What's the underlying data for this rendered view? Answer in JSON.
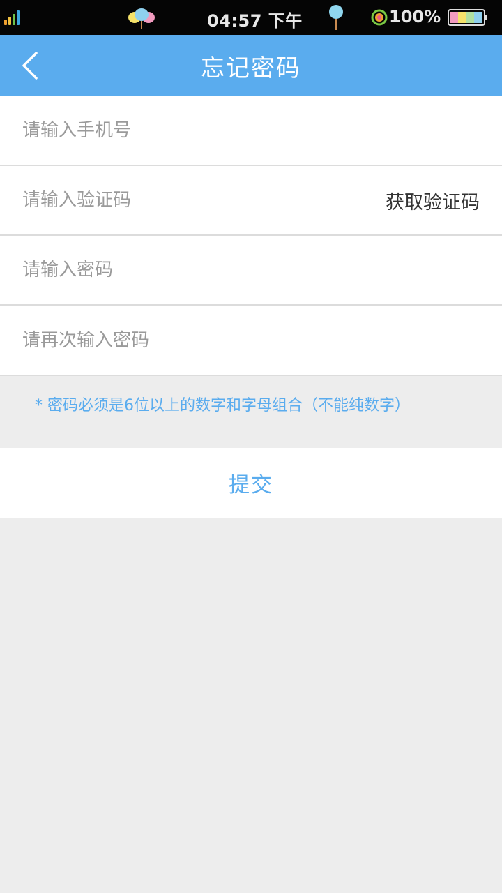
{
  "status_bar": {
    "time": "04:57 下午",
    "battery_percent": "100%",
    "icons": [
      "signal-icon",
      "balloons-icon",
      "pin-icon",
      "target-icon",
      "battery-icon"
    ]
  },
  "nav": {
    "title": "忘记密码",
    "back_icon": "chevron-left-icon"
  },
  "form": {
    "phone_placeholder": "请输入手机号",
    "code_placeholder": "请输入验证码",
    "get_code_label": "获取验证码",
    "password_placeholder": "请输入密码",
    "confirm_placeholder": "请再次输入密码"
  },
  "hint": "* 密码必须是6位以上的数字和字母组合（不能纯数字）",
  "submit_label": "提交",
  "colors": {
    "accent": "#5aacee",
    "background": "#ededed",
    "status_bar": "#050505"
  }
}
